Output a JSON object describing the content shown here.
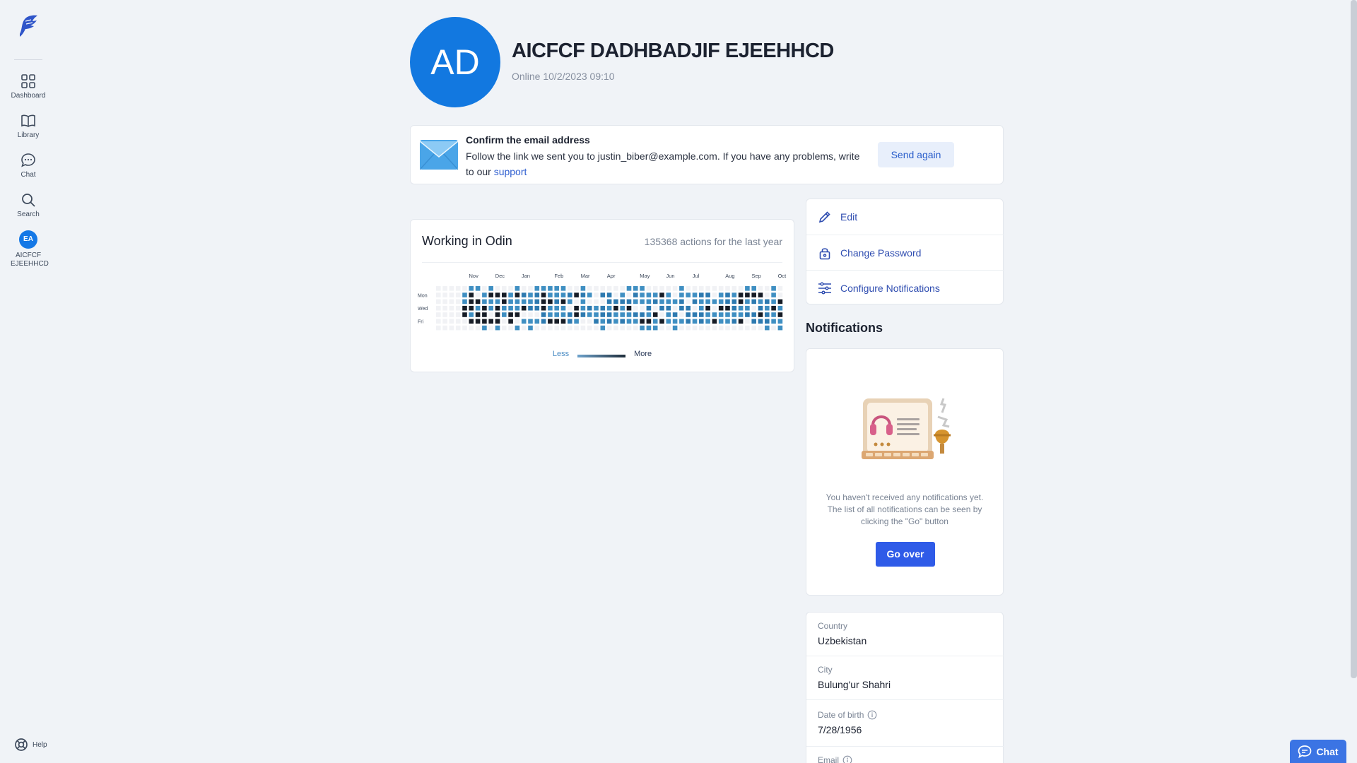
{
  "sidebar": {
    "items": [
      {
        "label": "Dashboard",
        "icon": "grid-icon"
      },
      {
        "label": "Library",
        "icon": "book-icon"
      },
      {
        "label": "Chat",
        "icon": "chat-bubble-icon"
      },
      {
        "label": "Search",
        "icon": "search-icon"
      }
    ],
    "user": {
      "initials": "EA",
      "name": "AICFCF EJEEHHCD"
    },
    "help_label": "Help"
  },
  "profile": {
    "initials": "AD",
    "name": "AICFCF DADHBADJIF EJEEHHCD",
    "status": "Online 10/2/2023 09:10"
  },
  "confirm_email": {
    "title": "Confirm the email address",
    "text_before": "Follow the link we sent you to justin_biber@example.com. If you have any problems, write to our ",
    "link_text": "support",
    "button_label": "Send again"
  },
  "activity": {
    "title": "Working in Odin",
    "count_text": "135368 actions for the last year",
    "months": [
      "Nov",
      "Dec",
      "Jan",
      "Feb",
      "Mar",
      "Apr",
      "May",
      "Jun",
      "Jul",
      "Aug",
      "Sep",
      "Oct"
    ],
    "days": [
      "Mon",
      "Wed",
      "Fri"
    ],
    "legend_less": "Less",
    "legend_more": "More",
    "colors": {
      "empty": "#f1f2f5",
      "level1": "#3f8fc2",
      "level2": "#2d7ab0",
      "level3": "#161c26"
    }
  },
  "actions": [
    {
      "label": "Edit",
      "icon": "pencil-icon"
    },
    {
      "label": "Change Password",
      "icon": "lock-icon"
    },
    {
      "label": "Configure Notifications",
      "icon": "sliders-icon"
    }
  ],
  "notifications": {
    "heading": "Notifications",
    "empty_text": "You haven't received any notifications yet. The list of all notifications can be seen by clicking the \"Go\" button",
    "button_label": "Go over"
  },
  "info": [
    {
      "label": "Country",
      "value": "Uzbekistan"
    },
    {
      "label": "City",
      "value": "Bulung'ur Shahri"
    },
    {
      "label": "Date of birth",
      "value": "7/28/1956",
      "info_icon": true
    },
    {
      "label": "Email",
      "value": "",
      "info_icon": true
    }
  ],
  "chat_button": {
    "label": "Chat"
  }
}
